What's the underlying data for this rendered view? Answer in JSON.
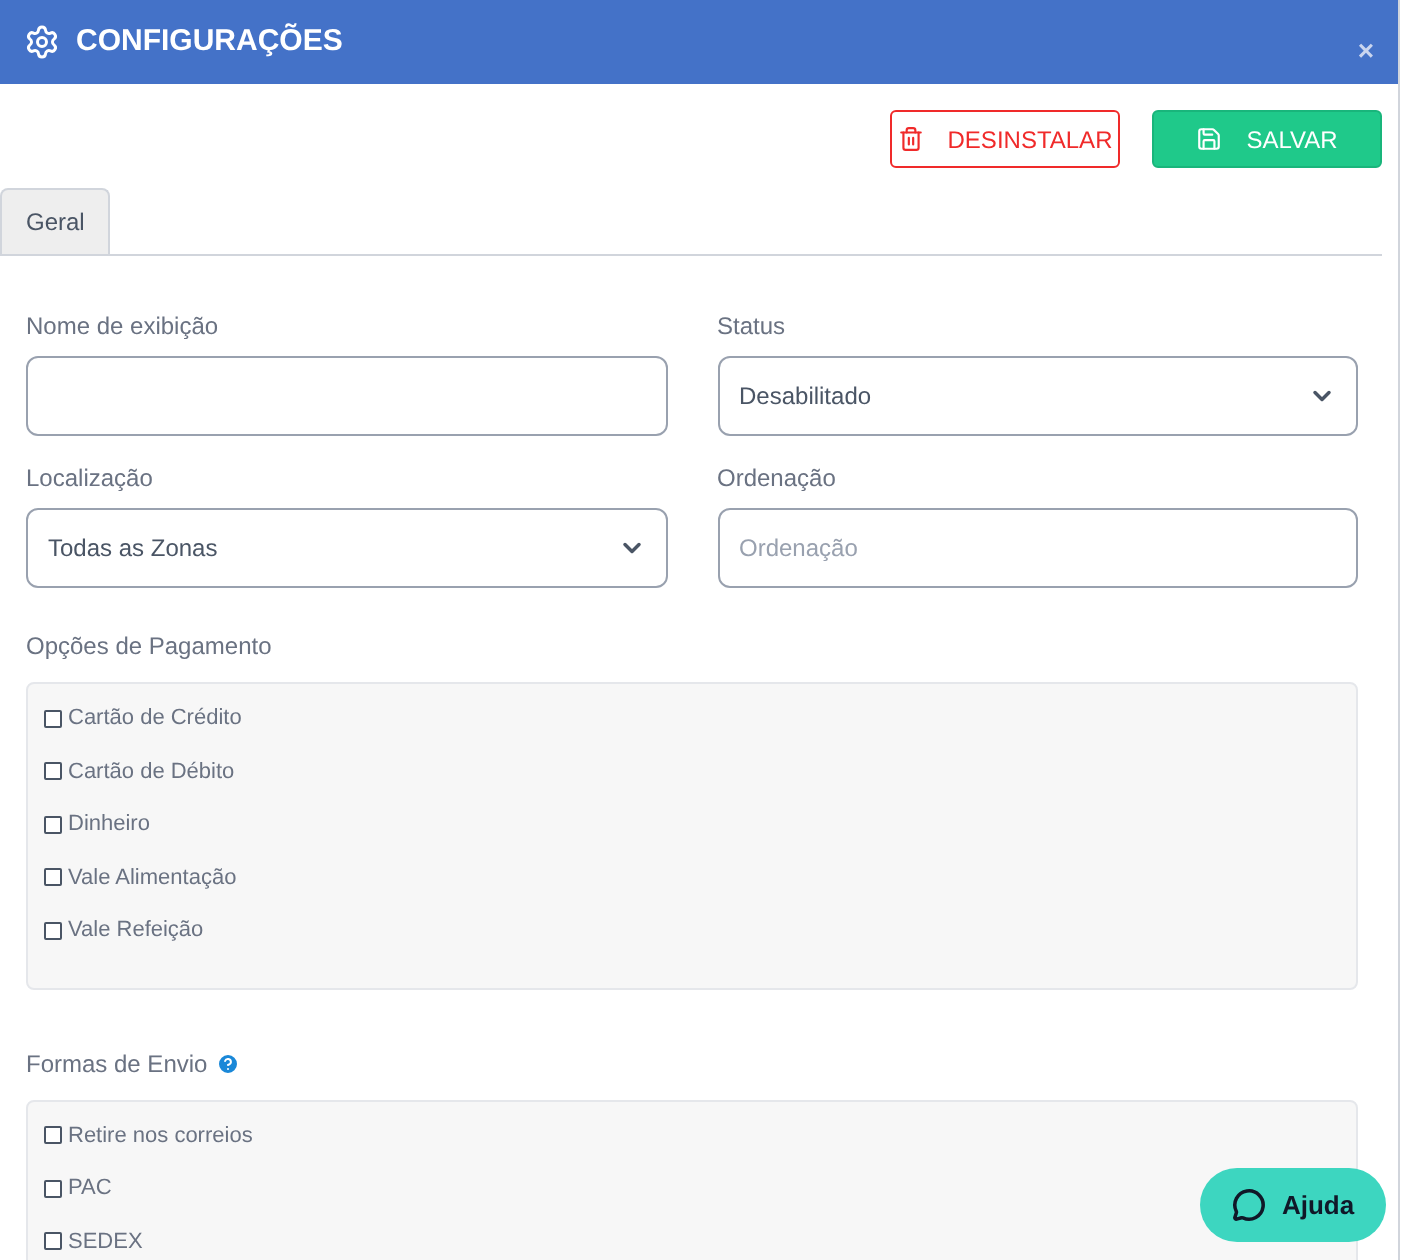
{
  "window": {
    "title": "CONFIGURAÇÕES",
    "close": "×"
  },
  "actions": [
    {
      "kind": "danger",
      "label": "DESINSTALAR"
    },
    {
      "kind": "primary",
      "label": "SALVAR"
    }
  ],
  "tabs": [
    {
      "label": "Geral",
      "selected": true
    }
  ],
  "fields": [
    {
      "kind": "text",
      "label": "Nome de exibição"
    },
    {
      "kind": "select",
      "label": "Status",
      "value": "Desabilitado"
    },
    {
      "kind": "select",
      "label": "Localização",
      "value": "Todas as Zonas"
    },
    {
      "kind": "text",
      "label": "Ordenação",
      "placeholder": "Ordenação"
    }
  ],
  "groups": [
    {
      "title": "Opções de Pagamento",
      "help": false,
      "items": [
        {
          "label": "Cartão de Crédito",
          "checked": false
        },
        {
          "label": "Cartão de Débito",
          "checked": false
        },
        {
          "label": "Dinheiro",
          "checked": false
        },
        {
          "label": "Vale Alimentação",
          "checked": false
        },
        {
          "label": "Vale Refeição",
          "checked": false
        }
      ]
    },
    {
      "title": "Formas de Envio",
      "help": true,
      "items": [
        {
          "label": "Retire nos correios",
          "checked": false
        },
        {
          "label": "PAC",
          "checked": false
        },
        {
          "label": "SEDEX",
          "checked": false
        }
      ]
    }
  ],
  "help_button": {
    "label": "Ajuda"
  }
}
